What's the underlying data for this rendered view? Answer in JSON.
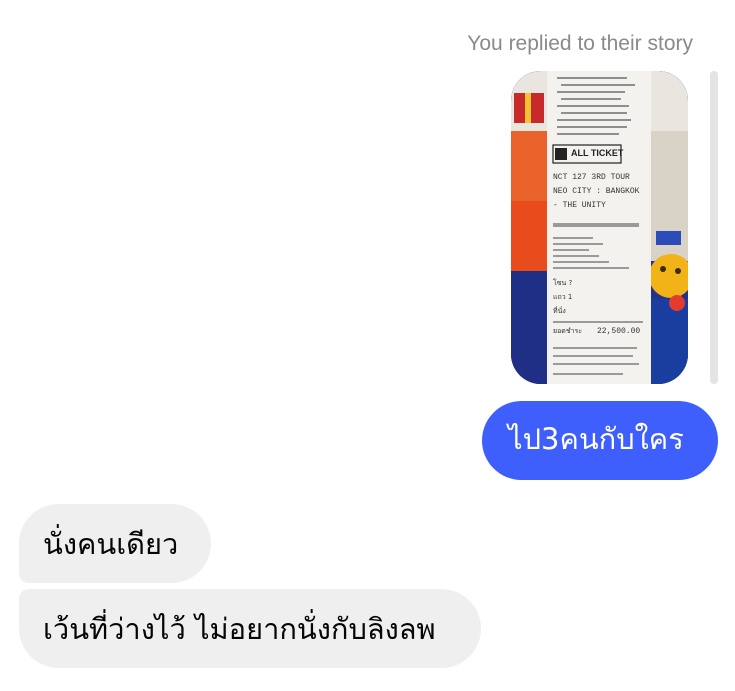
{
  "conversation": {
    "story_reply_label": "You replied to their story",
    "story": {
      "ticket_brand": "ALL TICKET",
      "ticket_lines": [
        "NCT 127 3RD TOUR",
        "NEO CITY : BANGKOK",
        "- THE UNITY"
      ],
      "zone_label": "โซน ?",
      "row_label": "แถว 1",
      "seat_label": "ที่นั่ง",
      "total_label": "ยอดชำระ",
      "total_value": "22,500.00"
    },
    "messages": [
      {
        "direction": "outgoing",
        "text": "ไป3คนกับใคร"
      },
      {
        "direction": "incoming",
        "text": "นั่งคนเดียว"
      },
      {
        "direction": "incoming",
        "text": "เว้นที่ว่างไว้ ไม่อยากนั่งกับลิงลพ"
      }
    ]
  },
  "colors": {
    "outgoing_bubble": "#3e5ffb",
    "incoming_bubble": "#efeff0",
    "meta_text": "#8a8a8e"
  }
}
